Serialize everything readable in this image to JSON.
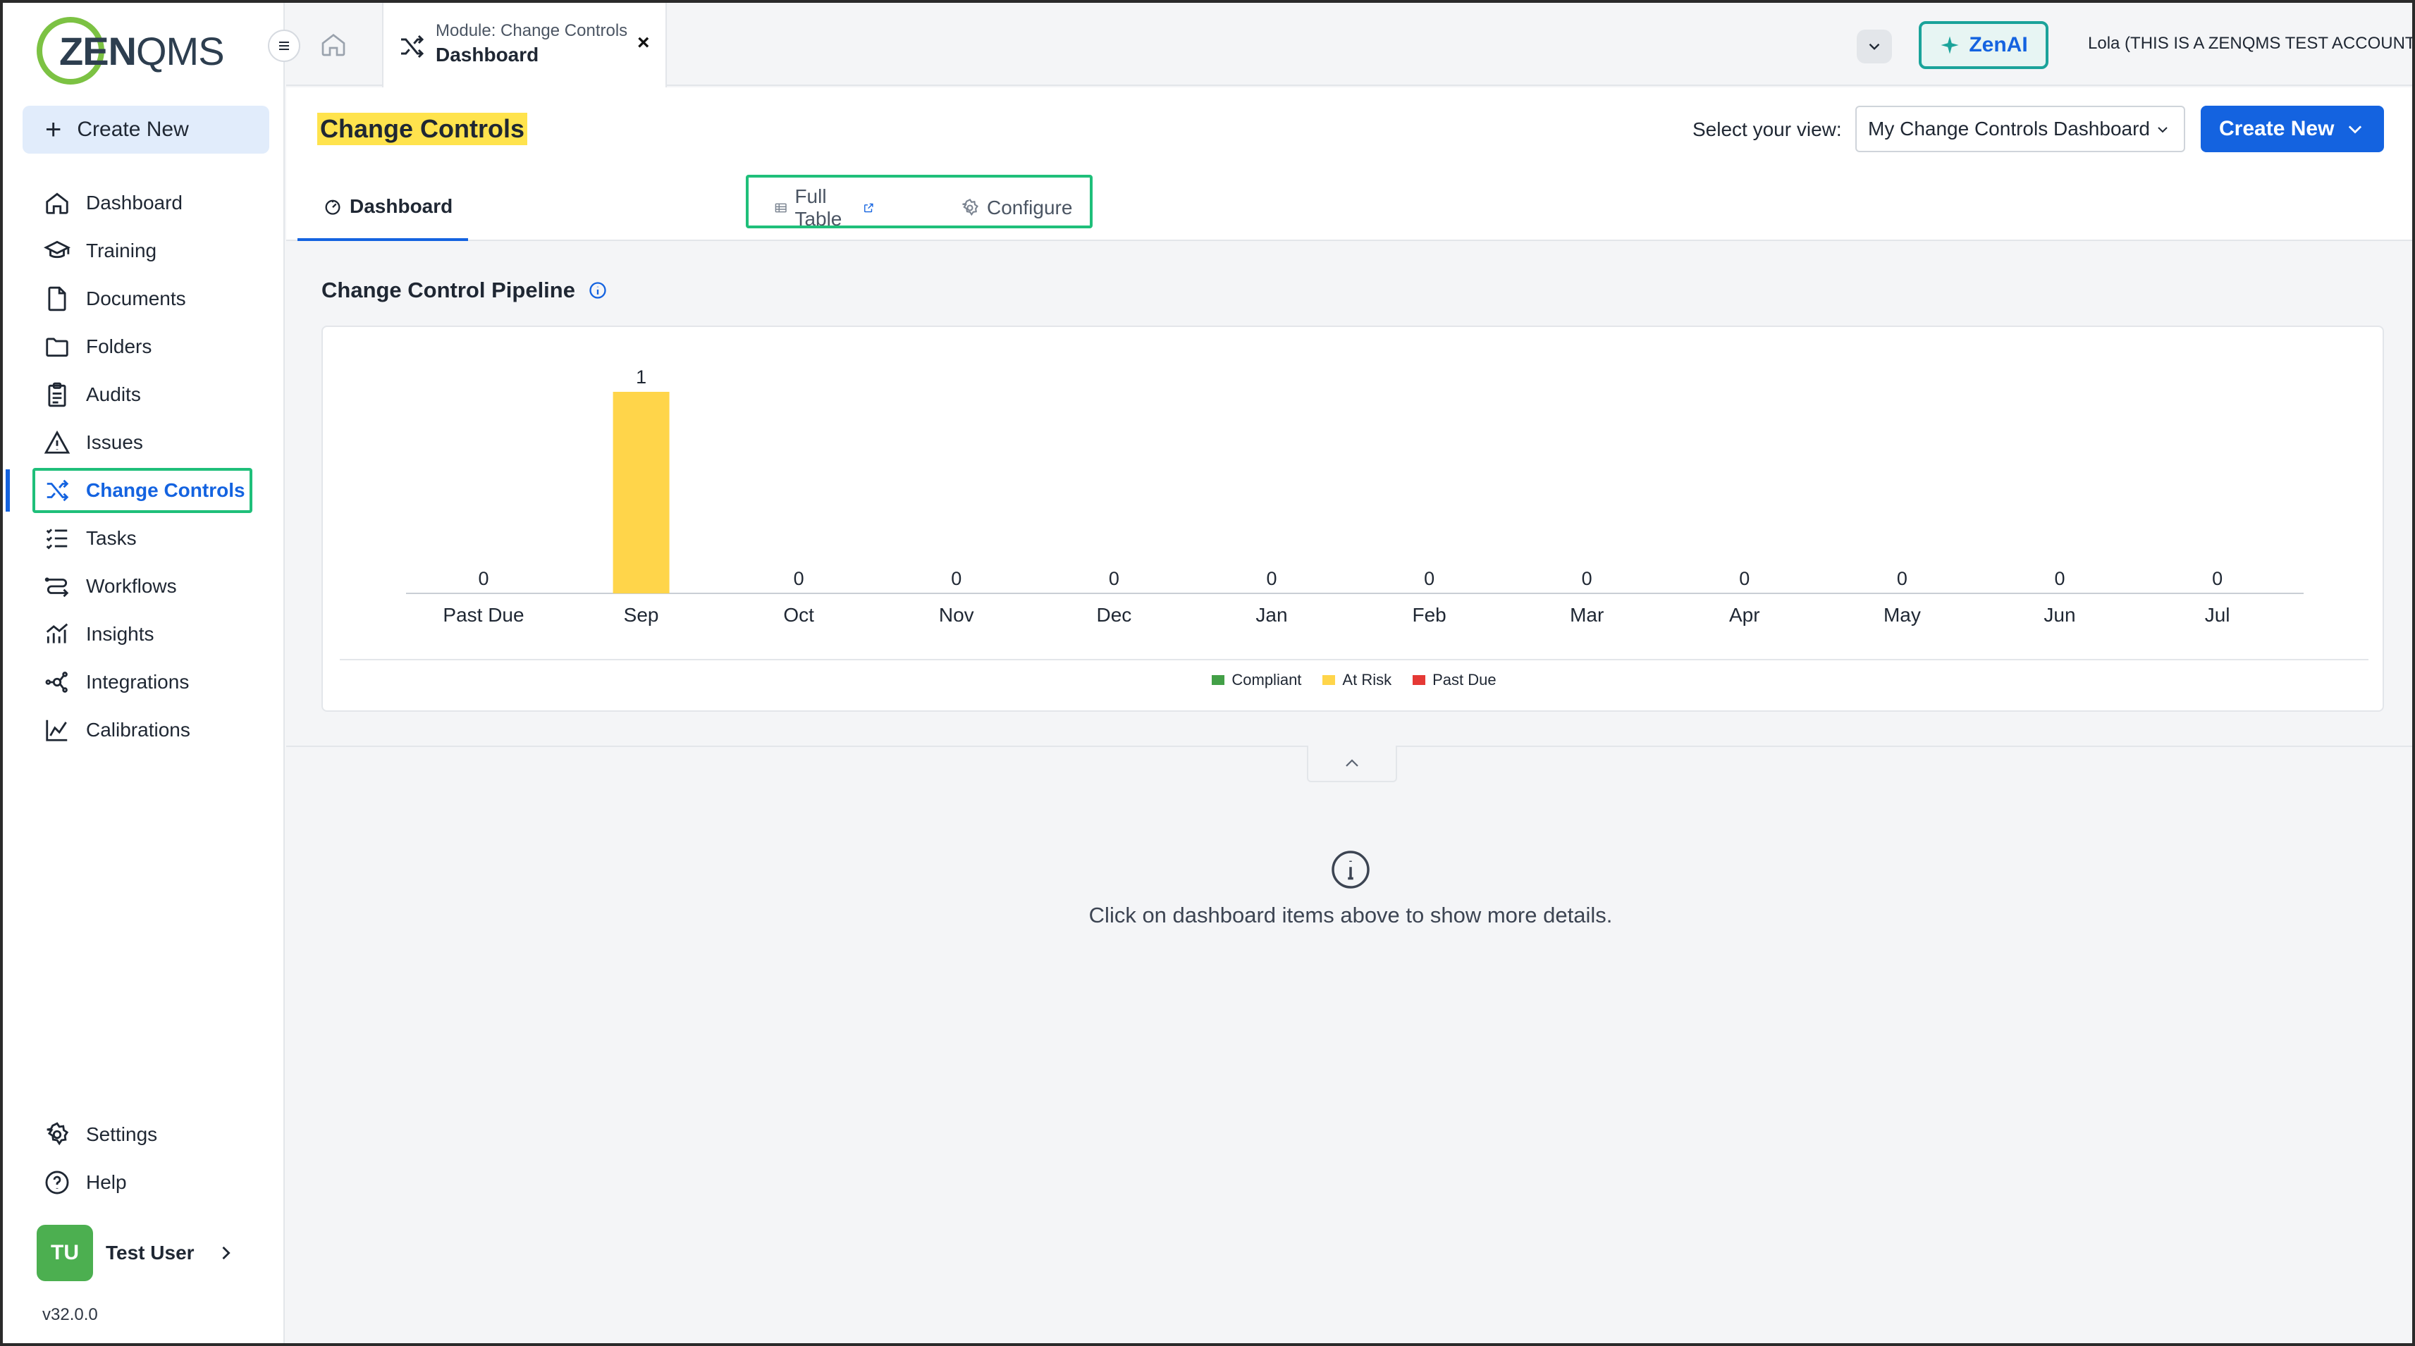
{
  "app": {
    "logo_text_bold": "ZEN",
    "logo_text_thin": "QMS"
  },
  "sidebar": {
    "create_new": "Create New",
    "items": [
      {
        "label": "Dashboard",
        "icon": "home-icon"
      },
      {
        "label": "Training",
        "icon": "graduation-cap-icon"
      },
      {
        "label": "Documents",
        "icon": "document-icon"
      },
      {
        "label": "Folders",
        "icon": "folder-icon"
      },
      {
        "label": "Audits",
        "icon": "clipboard-icon"
      },
      {
        "label": "Issues",
        "icon": "warning-icon"
      },
      {
        "label": "Change Controls",
        "icon": "shuffle-icon",
        "active": true
      },
      {
        "label": "Tasks",
        "icon": "task-list-icon"
      },
      {
        "label": "Workflows",
        "icon": "workflow-icon"
      },
      {
        "label": "Insights",
        "icon": "chart-bars-icon"
      },
      {
        "label": "Integrations",
        "icon": "network-icon"
      },
      {
        "label": "Calibrations",
        "icon": "line-chart-icon"
      }
    ],
    "bottom_items": [
      {
        "label": "Settings",
        "icon": "gear-icon"
      },
      {
        "label": "Help",
        "icon": "help-icon"
      }
    ],
    "user": {
      "initials": "TU",
      "name": "Test User"
    },
    "version": "v32.0.0"
  },
  "topbar": {
    "module_tab": {
      "subtitle": "Module: Change Controls",
      "title": "Dashboard",
      "close": "×"
    },
    "zenai_label": "ZenAI",
    "account": "Lola (THIS IS A ZENQMS TEST ACCOUNT)"
  },
  "header": {
    "title": "Change Controls",
    "view_label": "Select your view:",
    "view_value": "My Change Controls Dashboard",
    "create_new": "Create New",
    "tabs": [
      {
        "label": "Dashboard",
        "icon": "dashboard-gauge-icon",
        "active": true
      },
      {
        "label": "Full Table",
        "icon": "table-icon",
        "external": true
      },
      {
        "label": "Configure",
        "icon": "gear-icon"
      }
    ]
  },
  "pipeline": {
    "title": "Change Control Pipeline"
  },
  "chart_data": {
    "type": "bar",
    "title": "",
    "categories": [
      "Past Due",
      "Sep",
      "Oct",
      "Nov",
      "Dec",
      "Jan",
      "Feb",
      "Mar",
      "Apr",
      "May",
      "Jun",
      "Jul"
    ],
    "values": [
      0,
      1,
      0,
      0,
      0,
      0,
      0,
      0,
      0,
      0,
      0,
      0
    ],
    "bar_color": "#ffd54a",
    "ylim": [
      0,
      1
    ],
    "grid": false,
    "legend_position": "bottom",
    "legend": [
      {
        "name": "Compliant",
        "color": "#43a047"
      },
      {
        "name": "At Risk",
        "color": "#ffd54a"
      },
      {
        "name": "Past Due",
        "color": "#e53935"
      }
    ]
  },
  "empty_state": {
    "message": "Click on dashboard items above to show more details."
  },
  "colors": {
    "accent": "#1463e0",
    "highlight_box": "#1fbf7a",
    "title_highlight": "#ffe34d"
  }
}
